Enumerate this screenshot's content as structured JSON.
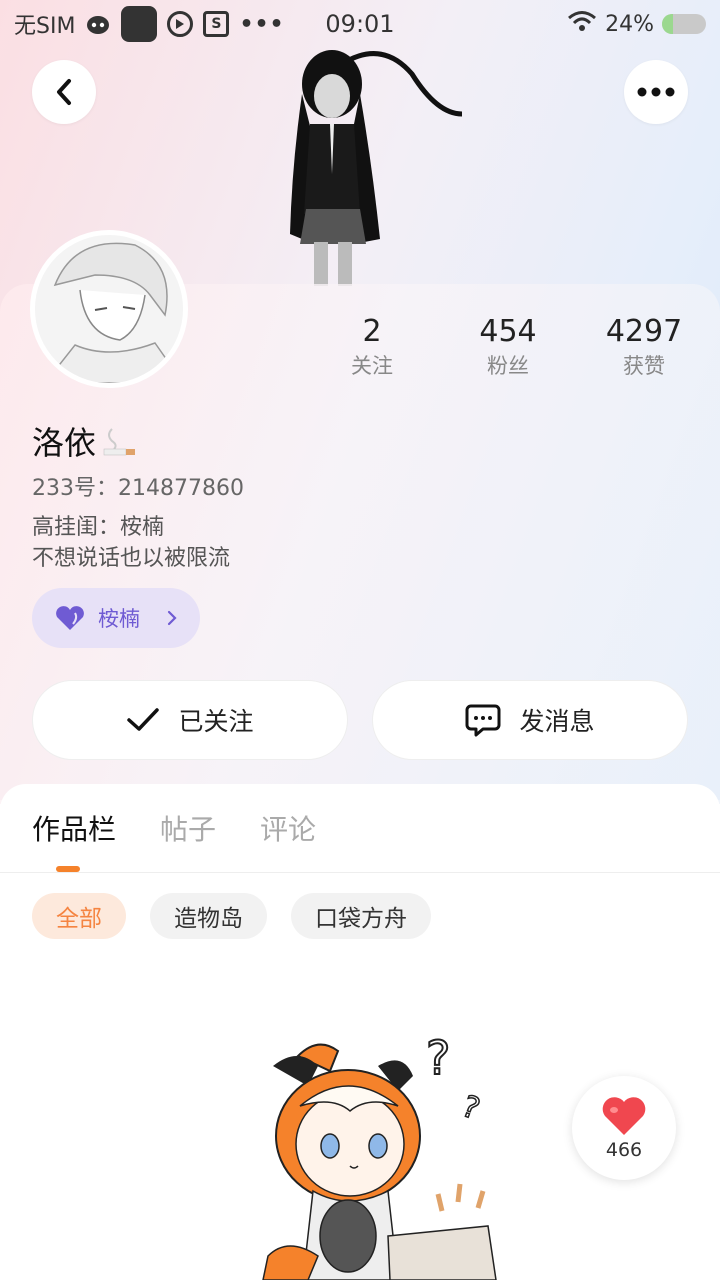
{
  "status_bar": {
    "sim": "无SIM",
    "time": "09:01",
    "battery": "24%",
    "battery_level": 0.24,
    "icons": [
      "cat-face-icon",
      "app-icon",
      "play-icon",
      "s-box-icon",
      "more-dots-icon",
      "wifi-icon",
      "battery-icon"
    ]
  },
  "header": {
    "back_icon": "chevron-left-icon",
    "more_icon": "more-horizontal-icon"
  },
  "profile": {
    "stats": [
      {
        "value": "2",
        "label": "关注"
      },
      {
        "value": "454",
        "label": "粉丝"
      },
      {
        "value": "4297",
        "label": "获赞"
      }
    ],
    "name": "洛依",
    "uid": "233号：214877860",
    "bio_line1": "高挂闺：桉楠",
    "bio_line2": "不想说话也以被限流",
    "guild": {
      "label": "桉楠",
      "icon": "heart-icon"
    },
    "follow_label": "已关注",
    "message_label": "发消息"
  },
  "tabs": [
    {
      "label": "作品栏",
      "active": true
    },
    {
      "label": "帖子",
      "active": false
    },
    {
      "label": "评论",
      "active": false
    }
  ],
  "chips": [
    {
      "label": "全部",
      "active": true
    },
    {
      "label": "造物岛",
      "active": false
    },
    {
      "label": "口袋方舟",
      "active": false
    }
  ],
  "like_float": {
    "count": "466"
  },
  "colors": {
    "accent_orange": "#f5822b",
    "guild_purple": "#6f5bd3",
    "heart_red": "#f0474f"
  }
}
